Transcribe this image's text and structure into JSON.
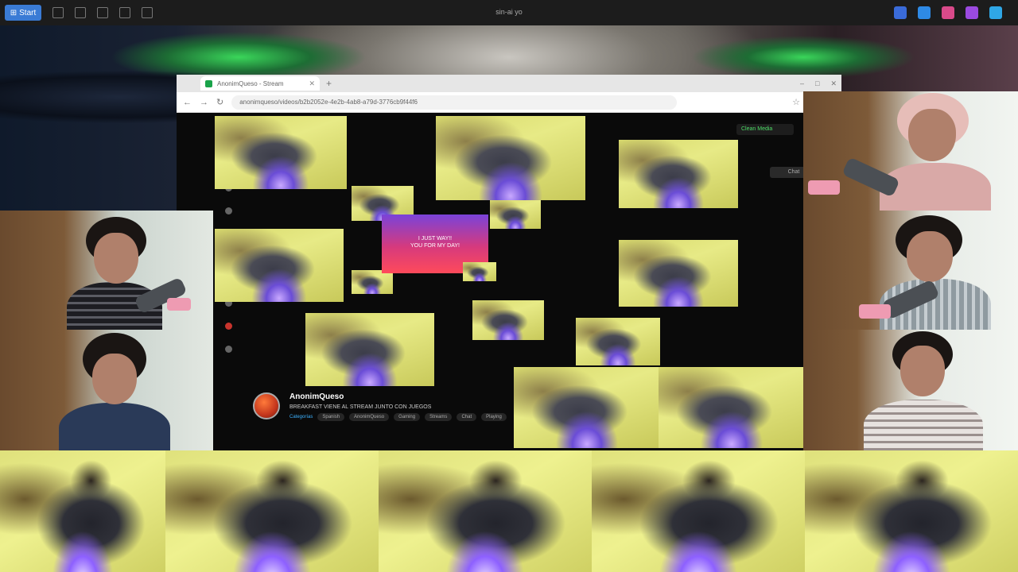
{
  "taskbar": {
    "start_label": "Start",
    "center_title": "sin-ai yo",
    "tray_colors": [
      "#3a6bd9",
      "#2e8ae6",
      "#d94a8a",
      "#9b4ae0",
      "#2fa7e6"
    ]
  },
  "browser": {
    "tab_title": "AnonimQueso - Stream",
    "url": "anonimqueso/videos/b2b2052e-4e2b-4ab8-a79d-3776cb9f44f6",
    "window_controls": [
      "–",
      "□",
      "✕"
    ]
  },
  "stream_page": {
    "top_chip": "Clean Media",
    "live_button": "Chat",
    "overlay_text_1": "I JUST WAY!!",
    "overlay_text_2": "YOU FOR MY DAY!",
    "channel": {
      "name": "AnonimQueso",
      "description": "BREAKFAST VIENE AL STREAM JUNTO CON JUEGOS",
      "tags_label": "Categorías",
      "tags": [
        "Spanish",
        "AnonimQueso",
        "Gaming",
        "Streams",
        "Chat",
        "Playing"
      ]
    }
  }
}
